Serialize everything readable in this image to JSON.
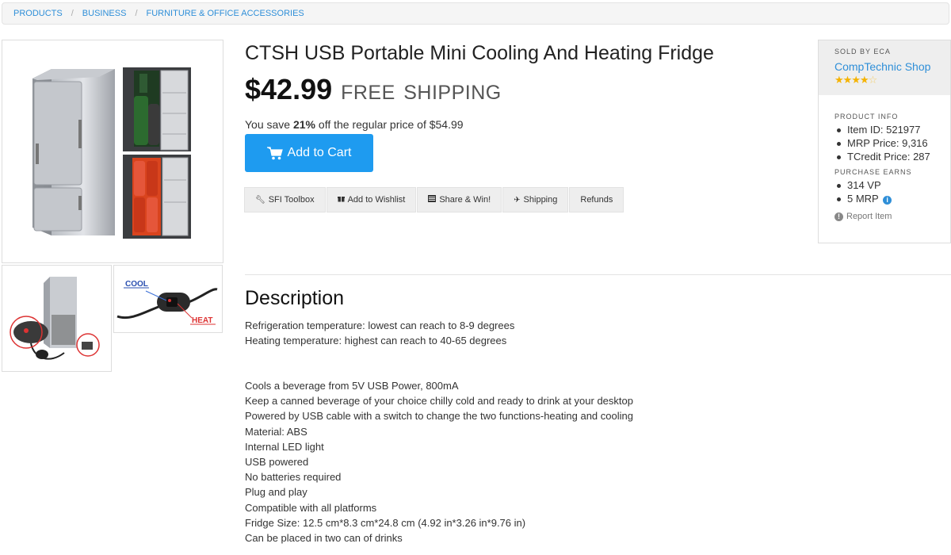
{
  "breadcrumb": [
    {
      "label": "PRODUCTS"
    },
    {
      "label": "BUSINESS"
    },
    {
      "label": "FURNITURE & OFFICE ACCESSORIES"
    }
  ],
  "breadcrumb_separator": "/",
  "product": {
    "title": "CTSH USB Portable Mini Cooling And Heating Fridge",
    "price": "$42.99",
    "shipping": "FREE SHIPPING",
    "savings_prefix": "You save ",
    "savings_percent": "21%",
    "savings_suffix": " off the regular price of $54.99",
    "add_to_cart_label": "Add to Cart",
    "thumbnail_labels": {
      "cool": "COOL",
      "heat": "HEAT"
    }
  },
  "actions": [
    {
      "icon": "wrench-icon",
      "label": "SFI Toolbox"
    },
    {
      "icon": "gift-icon",
      "label": "Add to Wishlist"
    },
    {
      "icon": "share-icon",
      "label": "Share & Win!"
    },
    {
      "icon": "plane-icon",
      "label": "Shipping"
    },
    {
      "icon": "",
      "label": "Refunds"
    }
  ],
  "description": {
    "heading": "Description",
    "lines_a": [
      "Refrigeration temperature: lowest can reach to 8-9 degrees",
      "Heating temperature: highest can reach to 40-65 degrees"
    ],
    "lines_b": [
      "Cools a beverage from 5V USB Power, 800mA",
      "Keep a canned beverage of your choice chilly cold and ready to drink at your desktop",
      "Powered by USB cable with a switch to change the two functions-heating and cooling",
      "Material: ABS",
      "Internal LED light",
      "USB powered",
      "No batteries required",
      "Plug and play",
      "Compatible with all platforms",
      "Fridge Size: 12.5 cm*8.3 cm*24.8 cm (4.92 in*3.26 in*9.76 in)",
      "Can be placed in two can of drinks"
    ]
  },
  "seller": {
    "sold_by_label": "SOLD BY ECA",
    "shop_name": "CompTechnic Shop",
    "rating": 4,
    "rating_max": 5,
    "star_color": "#f5b301"
  },
  "product_info": {
    "label": "PRODUCT INFO",
    "items": [
      "Item ID: 521977",
      "MRP Price: 9,316",
      "TCredit Price: 287"
    ]
  },
  "purchase_earns": {
    "label": "PURCHASE EARNS",
    "items": [
      "314 VP",
      "5 MRP"
    ]
  },
  "report_label": "Report Item",
  "colors": {
    "accent": "#1e9bf0",
    "link": "#2f8fd8"
  }
}
